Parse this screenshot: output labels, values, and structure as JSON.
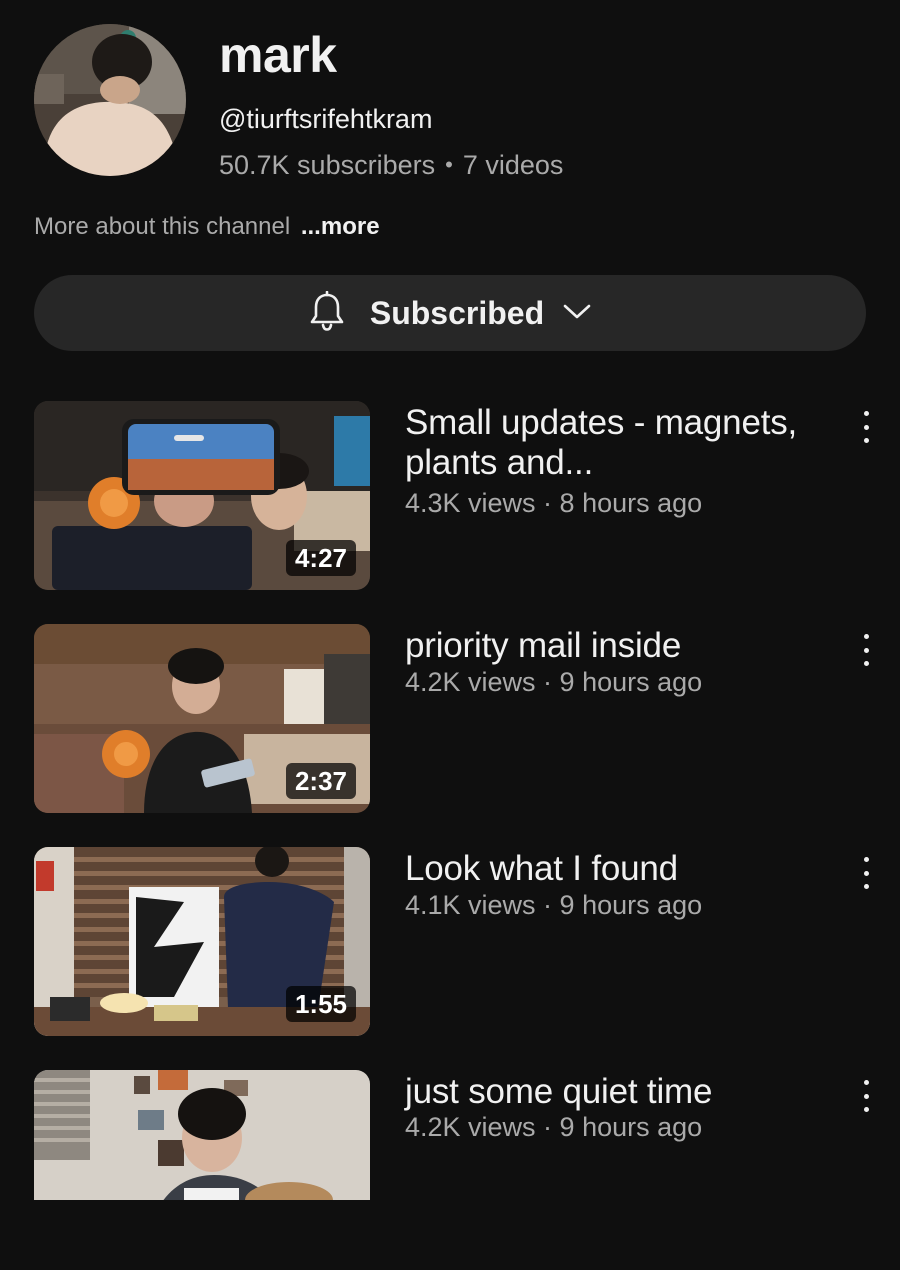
{
  "channel": {
    "name": "mark",
    "handle": "@tiurftsrifehtkram",
    "subscribers": "50.7K subscribers",
    "separator": "•",
    "video_count": "7 videos",
    "about": "More about this channel",
    "more": "...more"
  },
  "subscribe_button": {
    "label": "Subscribed",
    "icon": "bell-icon",
    "dropdown_icon": "chevron-down-icon"
  },
  "videos": [
    {
      "title": "Small updates - magnets, plants and...",
      "meta": "4.3K views · 8 hours ago",
      "duration": "4:27"
    },
    {
      "title": "priority mail inside",
      "meta": "4.2K views · 9 hours ago",
      "duration": "2:37"
    },
    {
      "title": "Look what I found",
      "meta": "4.1K views · 9 hours ago",
      "duration": "1:55"
    },
    {
      "title": "just some quiet time",
      "meta": "4.2K views · 9 hours ago",
      "duration": ""
    }
  ],
  "colors": {
    "background": "#0f0f0f",
    "button": "#272727",
    "primary_text": "#f1f1f1",
    "secondary_text": "#aaaaaa"
  }
}
